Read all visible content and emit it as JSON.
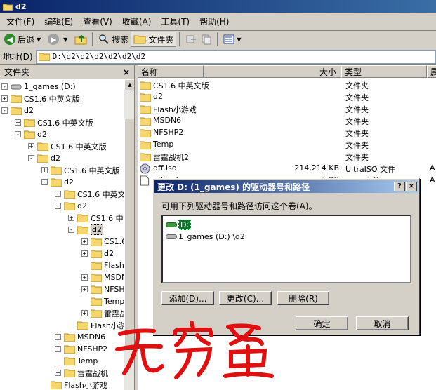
{
  "window": {
    "title": "d2"
  },
  "menu": [
    "文件(F)",
    "编辑(E)",
    "查看(V)",
    "收藏(A)",
    "工具(T)",
    "帮助(H)"
  ],
  "toolbar": {
    "back": "后退",
    "search": "搜索",
    "folders": "文件夹"
  },
  "address": {
    "label": "地址(D)",
    "path": "D:\\d2\\d2\\d2\\d2\\d2\\d2"
  },
  "folder_pane": {
    "header": "文件夹",
    "close": "×",
    "tree": [
      {
        "label": "1_games (D:)",
        "depth": 0,
        "pm": "-"
      },
      {
        "label": "CS1.6 中英文版",
        "depth": 0,
        "pm": "+"
      },
      {
        "label": "d2",
        "depth": 0,
        "pm": "-"
      },
      {
        "label": "CS1.6 中英文版",
        "depth": 1,
        "pm": "+"
      },
      {
        "label": "d2",
        "depth": 1,
        "pm": "-"
      },
      {
        "label": "CS1.6 中英文版",
        "depth": 2,
        "pm": "+"
      },
      {
        "label": "d2",
        "depth": 2,
        "pm": "-"
      },
      {
        "label": "CS1.6 中英文版",
        "depth": 3,
        "pm": "+"
      },
      {
        "label": "d2",
        "depth": 3,
        "pm": "-"
      },
      {
        "label": "CS1.6 中英文",
        "depth": 4,
        "pm": "+"
      },
      {
        "label": "d2",
        "depth": 4,
        "pm": "-"
      },
      {
        "label": "CS1.6 中",
        "depth": 5,
        "pm": "+"
      },
      {
        "label": "d2",
        "depth": 5,
        "pm": "-",
        "selected": true
      },
      {
        "label": "CS1.6",
        "depth": 6,
        "pm": "+"
      },
      {
        "label": "d2",
        "depth": 6,
        "pm": "+"
      },
      {
        "label": "Flash",
        "depth": 6,
        "pm": ""
      },
      {
        "label": "MSDN6",
        "depth": 6,
        "pm": "+"
      },
      {
        "label": "NFSHP",
        "depth": 6,
        "pm": "+"
      },
      {
        "label": "Temp",
        "depth": 6,
        "pm": ""
      },
      {
        "label": "雷霆战",
        "depth": 6,
        "pm": "+"
      },
      {
        "label": "Flash小游",
        "depth": 5,
        "pm": ""
      },
      {
        "label": "MSDN6",
        "depth": 4,
        "pm": "+"
      },
      {
        "label": "NFSHP2",
        "depth": 4,
        "pm": "+"
      },
      {
        "label": "Temp",
        "depth": 4,
        "pm": ""
      },
      {
        "label": "雷霆战机",
        "depth": 4,
        "pm": "+"
      },
      {
        "label": "Flash小游戏",
        "depth": 3,
        "pm": ""
      }
    ]
  },
  "file_list": {
    "columns": [
      "名称",
      "大小",
      "类型",
      "属"
    ],
    "rows": [
      {
        "name": "CS1.6 中英文版",
        "size": "",
        "type": "文件夹",
        "attr": "",
        "icon": "folder"
      },
      {
        "name": "d2",
        "size": "",
        "type": "文件夹",
        "attr": "",
        "icon": "folder"
      },
      {
        "name": "Flash小游戏",
        "size": "",
        "type": "文件夹",
        "attr": "",
        "icon": "folder"
      },
      {
        "name": "MSDN6",
        "size": "",
        "type": "文件夹",
        "attr": "",
        "icon": "folder"
      },
      {
        "name": "NFSHP2",
        "size": "",
        "type": "文件夹",
        "attr": "",
        "icon": "folder"
      },
      {
        "name": "Temp",
        "size": "",
        "type": "文件夹",
        "attr": "",
        "icon": "folder"
      },
      {
        "name": "雷霆战机2",
        "size": "",
        "type": "文件夹",
        "attr": "",
        "icon": "folder"
      },
      {
        "name": "dff.iso",
        "size": "214,214 KB",
        "type": "UltraISO 文件",
        "attr": "A",
        "icon": "disc"
      },
      {
        "name": "dff.mds",
        "size": "1 KB",
        "type": "MDF 文件",
        "attr": "A",
        "icon": "doc"
      }
    ]
  },
  "dialog": {
    "title": "更改 D: (1_games) 的驱动器号和路径",
    "help": "?",
    "close": "×",
    "description": "可用下列驱动器号和路径访问这个卷(A)。",
    "items": [
      "D:",
      "1_games (D:) \\d2"
    ],
    "buttons": {
      "add": "添加(D)...",
      "change": "更改(C)...",
      "remove": "删除(R)",
      "ok": "确定",
      "cancel": "取消"
    }
  },
  "watermark": {
    "text": "无穷蛋"
  }
}
